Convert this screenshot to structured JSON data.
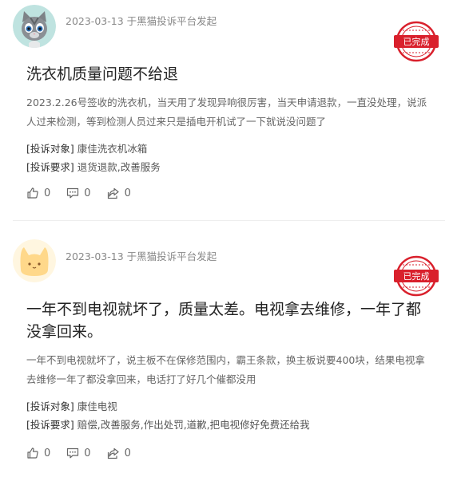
{
  "complaints": [
    {
      "meta": "2023-03-13 于黑猫投诉平台发起",
      "status": "已完成",
      "title": "洗衣机质量问题不给退",
      "description": "2023.2.26号签收的洗衣机，当天用了发现异响很厉害，当天申请退款，一直没处理，说派人过来检测，等到检测人员过来只是插电开机试了一下就说没问题了",
      "target_label": "[投诉对象]",
      "target": "康佳洗衣机冰箱",
      "request_label": "[投诉要求]",
      "request": "退货退款,改善服务",
      "likes": "0",
      "comments": "0",
      "shares": "0"
    },
    {
      "meta": "2023-03-13 于黑猫投诉平台发起",
      "status": "已完成",
      "title": "一年不到电视就坏了，质量太差。电视拿去维修，一年了都没拿回来。",
      "description": "一年不到电视就坏了，说主板不在保修范围内，霸王条款，换主板说要400块，结果电视拿去维修一年了都没拿回来，电话打了好几个催都没用",
      "target_label": "[投诉对象]",
      "target": "康佳电视",
      "request_label": "[投诉要求]",
      "request": "赔偿,改善服务,作出处罚,道歉,把电视修好免费还给我",
      "likes": "0",
      "comments": "0",
      "shares": "0"
    }
  ],
  "colors": {
    "stamp_red": "#d9202c",
    "text_primary": "#222222",
    "text_secondary": "#666666",
    "meta": "#888888"
  },
  "icons": {
    "avatar_1": "gray-cat-avatar-icon",
    "avatar_2": "yellow-cat-avatar-icon",
    "like": "thumbs-up-icon",
    "comment": "comment-icon",
    "share": "share-icon"
  }
}
